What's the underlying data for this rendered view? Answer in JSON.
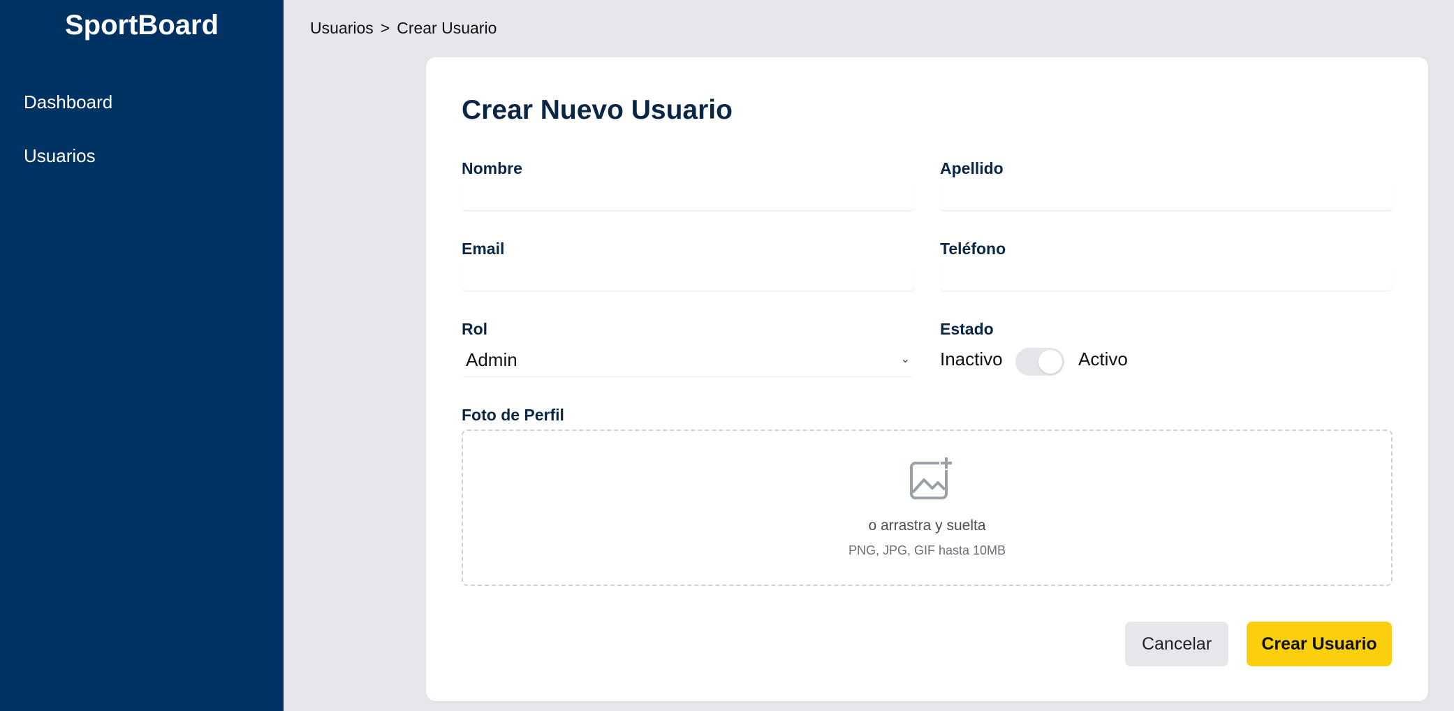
{
  "sidebar": {
    "brand": "SportBoard",
    "items": [
      {
        "label": "Dashboard"
      },
      {
        "label": "Usuarios"
      }
    ]
  },
  "breadcrumb": {
    "parent": "Usuarios",
    "separator": ">",
    "current": "Crear Usuario"
  },
  "form": {
    "title": "Crear Nuevo Usuario",
    "nombre": {
      "label": "Nombre",
      "value": ""
    },
    "apellido": {
      "label": "Apellido",
      "value": ""
    },
    "email": {
      "label": "Email",
      "value": ""
    },
    "telefono": {
      "label": "Teléfono",
      "value": ""
    },
    "rol": {
      "label": "Rol",
      "value": "Admin"
    },
    "estado": {
      "label": "Estado",
      "off_label": "Inactivo",
      "on_label": "Activo",
      "active": true
    },
    "foto": {
      "label": "Foto de Perfil",
      "drop_text": "o arrastra y suelta",
      "hint": "PNG, JPG, GIF hasta 10MB",
      "icon": "image-add-icon"
    },
    "actions": {
      "cancel": "Cancelar",
      "submit": "Crear Usuario"
    }
  },
  "colors": {
    "sidebar": "#003263",
    "accent": "#fccf0e",
    "background": "#e6e7eb",
    "title": "#0b2545"
  }
}
